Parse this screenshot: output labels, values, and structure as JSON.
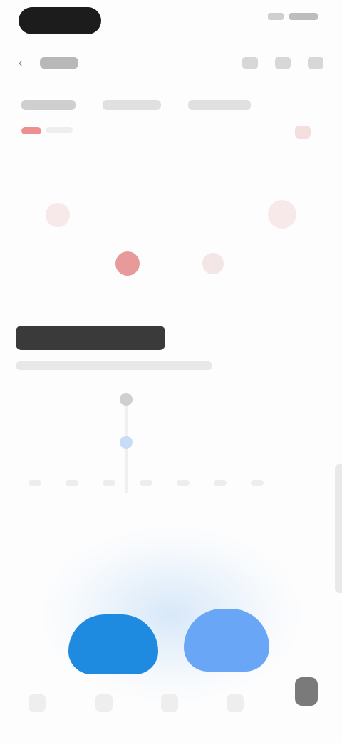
{
  "colors": {
    "accent_red": "#e98f8f",
    "accent_blue": "#1e8be0",
    "accent_light_blue": "#6aa6f6",
    "dark": "#1c1c1c"
  },
  "icons": {
    "back": "back-arrow-icon",
    "actions": [
      "more-icon",
      "share-icon",
      "menu-icon"
    ]
  }
}
